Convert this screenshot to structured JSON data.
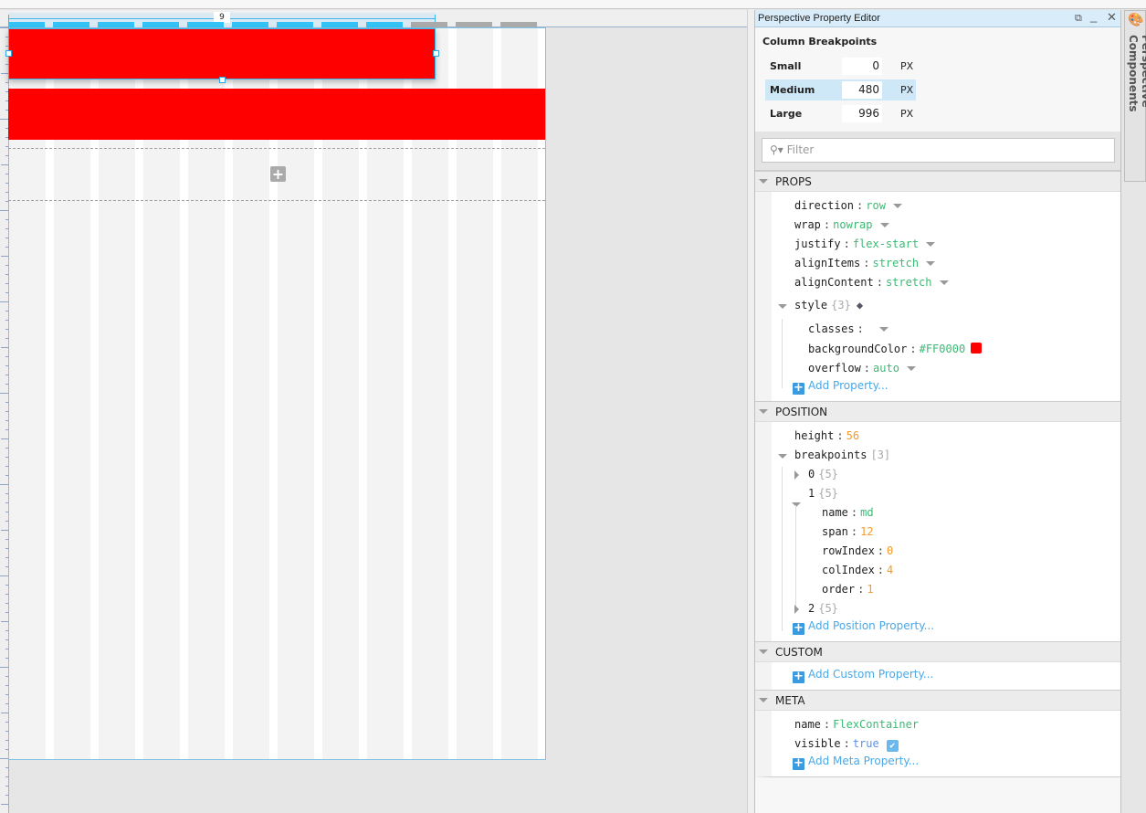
{
  "designer": {
    "selection_span_label": "9",
    "columns": 12,
    "selected_span": 9,
    "add_row_icon": "plus-icon",
    "components": [
      {
        "name": "flex-container-selected",
        "color": "#FF0000",
        "span": 9
      },
      {
        "name": "flex-container",
        "color": "#FF0000",
        "span": 12
      }
    ]
  },
  "panel": {
    "title": "Perspective Property Editor",
    "column_breakpoints_title": "Column Breakpoints",
    "breakpoints": [
      {
        "label": "Small",
        "value": "0",
        "unit": "PX"
      },
      {
        "label": "Medium",
        "value": "480",
        "unit": "PX",
        "selected": true
      },
      {
        "label": "Large",
        "value": "996",
        "unit": "PX"
      }
    ],
    "filter_placeholder": "Filter",
    "sections": {
      "props": {
        "title": "PROPS",
        "direction": {
          "key": "direction",
          "value": "row"
        },
        "wrap": {
          "key": "wrap",
          "value": "nowrap"
        },
        "justify": {
          "key": "justify",
          "value": "flex-start"
        },
        "alignItems": {
          "key": "alignItems",
          "value": "stretch"
        },
        "alignContent": {
          "key": "alignContent",
          "value": "stretch"
        },
        "style": {
          "key": "style",
          "count": "{3}",
          "classes": {
            "key": "classes",
            "value": ""
          },
          "backgroundColor": {
            "key": "backgroundColor",
            "value": "#FF0000"
          },
          "overflow": {
            "key": "overflow",
            "value": "auto"
          }
        },
        "add": "Add Property..."
      },
      "position": {
        "title": "POSITION",
        "height": {
          "key": "height",
          "value": "56"
        },
        "breakpoints": {
          "key": "breakpoints",
          "count": "[3]"
        },
        "bp0": {
          "key": "0",
          "count": "{5}"
        },
        "bp1": {
          "key": "1",
          "count": "{5}",
          "name": {
            "key": "name",
            "value": "md"
          },
          "span": {
            "key": "span",
            "value": "12"
          },
          "rowIndex": {
            "key": "rowIndex",
            "value": "0"
          },
          "colIndex": {
            "key": "colIndex",
            "value": "4"
          },
          "order": {
            "key": "order",
            "value": "1"
          }
        },
        "bp2": {
          "key": "2",
          "count": "{5}"
        },
        "add": "Add Position Property..."
      },
      "custom": {
        "title": "CUSTOM",
        "add": "Add Custom Property..."
      },
      "meta": {
        "title": "META",
        "name": {
          "key": "name",
          "value": "FlexContainer"
        },
        "visible": {
          "key": "visible",
          "value": "true",
          "checked": true
        },
        "add": "Add Meta Property..."
      }
    }
  },
  "side_tab": {
    "label": "Perspective Components"
  }
}
